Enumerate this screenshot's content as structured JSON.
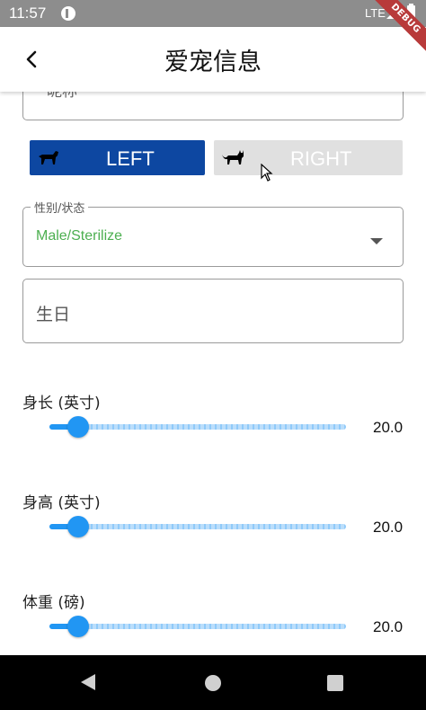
{
  "status_bar": {
    "time": "11:57",
    "network": "LTE"
  },
  "debug_banner": "DEBUG",
  "app_bar": {
    "title": "爱宠信息"
  },
  "form": {
    "nickname_placeholder": "昵称",
    "toggle": {
      "left_label": "LEFT",
      "right_label": "RIGHT",
      "selected": "LEFT",
      "left_icon": "dog-icon",
      "right_icon": "cat-icon"
    },
    "gender": {
      "label": "性别/状态",
      "value": "Male/Sterilize"
    },
    "birthday_placeholder": "生日",
    "sliders": [
      {
        "label": "身长 (英寸)",
        "value": "20.0"
      },
      {
        "label": "身高 (英寸)",
        "value": "20.0"
      },
      {
        "label": "体重 (磅)",
        "value": "20.0"
      }
    ]
  },
  "colors": {
    "primary": "#0d47a1",
    "accent": "#2196f3",
    "gender_value": "#4caf50",
    "toggle_inactive": "#e0e0e0"
  }
}
